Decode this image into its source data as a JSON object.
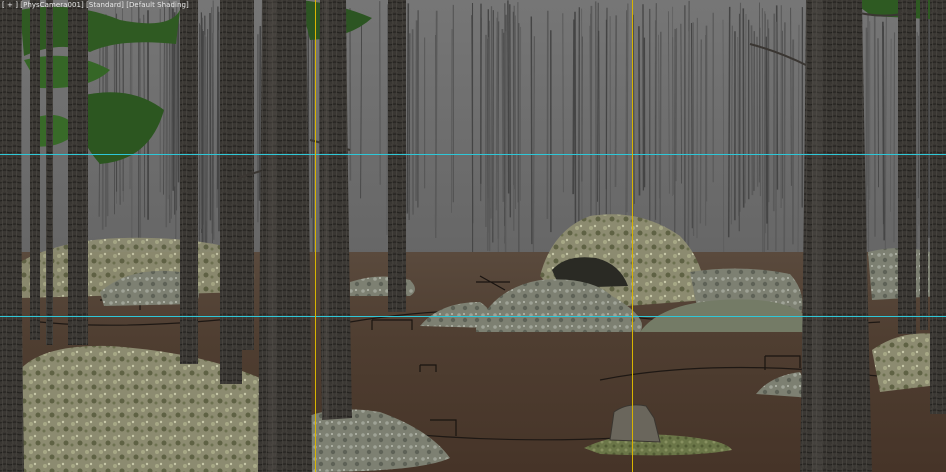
{
  "viewport": {
    "camera_label": "PhysCamera001",
    "renderer_label": "Standard",
    "shading_label": "Default Shading"
  },
  "guides": {
    "horizontal_color": "#2ec8d8",
    "vertical_color": "#d8b400",
    "horizontal_count": 2,
    "vertical_count": 2
  },
  "colors": {
    "background_forest": "#707070",
    "ground": "#4e3c30",
    "bark_dark": "#36332f",
    "bark_light": "#4d4a46",
    "foliage": "#2f5a22",
    "rock": "#8a8a72",
    "moss": "#6f7c4a"
  }
}
